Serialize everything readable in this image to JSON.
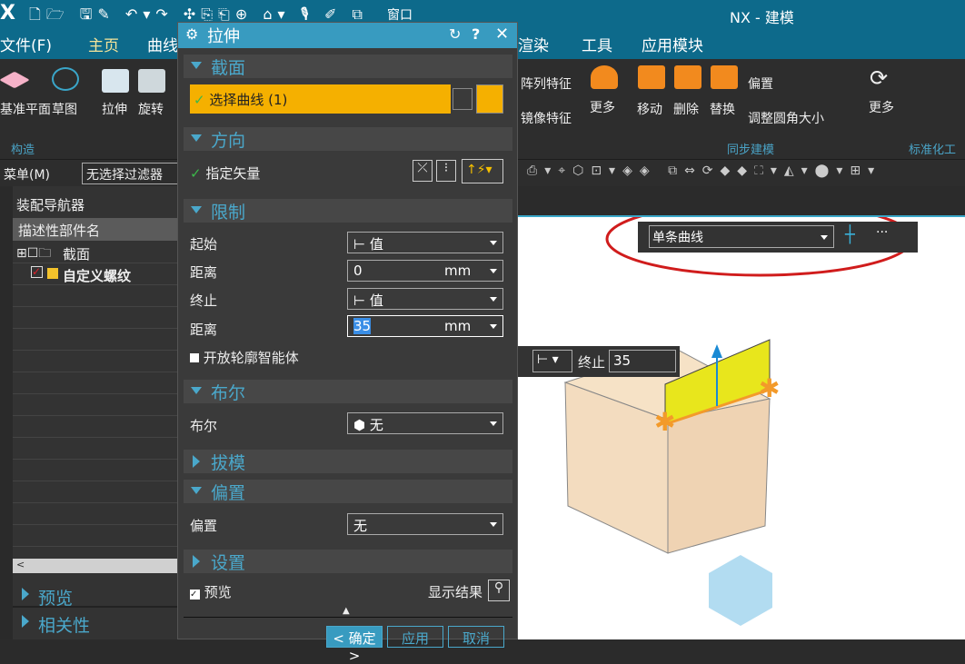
{
  "app": {
    "logo": "X",
    "title": "NX - 建模",
    "quick_access": {
      "window_label": "窗口"
    }
  },
  "menu": [
    "文件(F)",
    "主页",
    "曲线",
    "渲染",
    "工具",
    "应用模块"
  ],
  "ribbon": {
    "left": [
      {
        "label": "基准平面"
      },
      {
        "label": "草图"
      },
      {
        "label": "拉伸"
      },
      {
        "label": "旋转"
      }
    ],
    "group_construct": "构造",
    "features": [
      "阵列特征",
      "镜像特征"
    ],
    "more1": "更多",
    "sync": [
      {
        "label": "移动"
      },
      {
        "label": "删除"
      },
      {
        "label": "替换"
      }
    ],
    "sync_small": [
      "偏置",
      "调整圆角大小"
    ],
    "more2": "更多",
    "group_sync": "同步建模",
    "group_std": "标准化工"
  },
  "toolbar": {
    "menu_label": "菜单(M)",
    "filter_value": "无选择过滤器"
  },
  "nav": {
    "title": "装配导航器",
    "column": "描述性部件名",
    "items": [
      {
        "label": "截面",
        "checked": false
      },
      {
        "label": "自定义螺纹",
        "checked": true
      }
    ],
    "panels": [
      "预览",
      "相关性"
    ]
  },
  "dialog": {
    "title": "拉伸",
    "sections": {
      "section": {
        "title": "截面",
        "select_curve": "选择曲线 (1)"
      },
      "direction": {
        "title": "方向",
        "specify_vector": "指定矢量"
      },
      "limits": {
        "title": "限制",
        "start_label": "起始",
        "start_value": "值",
        "dist1_label": "距离",
        "dist1_value": "0",
        "dist1_unit": "mm",
        "end_label": "终止",
        "end_value": "值",
        "dist2_label": "距离",
        "dist2_value": "35",
        "dist2_unit": "mm",
        "open_profile": "开放轮廓智能体",
        "open_profile_checked": false
      },
      "boolean": {
        "title": "布尔",
        "label": "布尔",
        "value": "无"
      },
      "draft": {
        "title": "拔模"
      },
      "offset": {
        "title": "偏置",
        "label": "偏置",
        "value": "无"
      },
      "settings": {
        "title": "设置"
      }
    },
    "preview_label": "预览",
    "preview_checked": true,
    "show_result": "显示结果",
    "ok": "< 确定 >",
    "apply": "应用",
    "cancel": "取消"
  },
  "viewport": {
    "curve_rule": "单条曲线",
    "end_label": "终止",
    "end_value": "35"
  },
  "colors": {
    "accent": "#389bc0",
    "select_highlight": "#f5b000",
    "titlebar": "#0d6a8b",
    "annotation": "#d01c1c",
    "face": "#e8e61c"
  }
}
